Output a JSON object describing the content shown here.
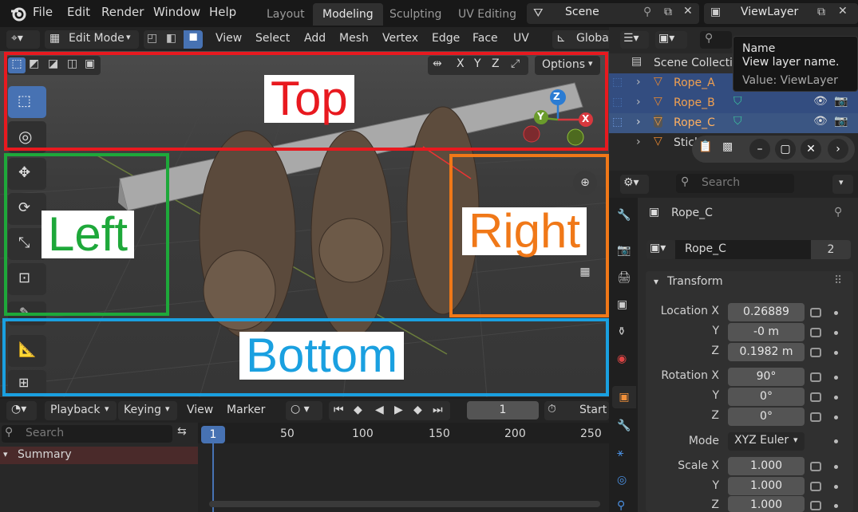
{
  "topbar": {
    "menus": [
      "File",
      "Edit",
      "Render",
      "Window",
      "Help"
    ],
    "workspaces": [
      "Layout",
      "Modeling",
      "Sculpting",
      "UV Editing"
    ],
    "active_workspace": "Modeling",
    "scene": "Scene",
    "view_layer": "ViewLayer"
  },
  "viewport_header": {
    "mode": "Edit Mode",
    "menus": [
      "View",
      "Select",
      "Add",
      "Mesh",
      "Vertex",
      "Edge",
      "Face",
      "UV"
    ],
    "transform_orientation": "Globa",
    "axis_x": "X",
    "axis_y": "Y",
    "axis_z": "Z",
    "options": "Options"
  },
  "gizmo": {
    "z": "Z",
    "y": "Y",
    "x": "X"
  },
  "overlays": {
    "top": {
      "label": "Top",
      "color": "#e8191f"
    },
    "left": {
      "label": "Left",
      "color": "#1ea83a"
    },
    "right": {
      "label": "Right",
      "color": "#f07818"
    },
    "bottom": {
      "label": "Bottom",
      "color": "#1aa0e0"
    }
  },
  "timeline": {
    "menus": [
      "Playback",
      "Keying",
      "View",
      "Marker"
    ],
    "current_frame": "1",
    "start_label": "Start",
    "search_placeholder": "Search",
    "summary": "Summary",
    "ruler": [
      "1",
      "50",
      "100",
      "150",
      "200",
      "250"
    ]
  },
  "outliner": {
    "header": "Scene Collecti",
    "items": [
      "Rope_A",
      "Rope_B",
      "Rope_C",
      "Stick"
    ]
  },
  "tooltip": {
    "title": "Name",
    "desc": "View layer name.",
    "value": "Value: ViewLayer"
  },
  "properties": {
    "search_placeholder": "Search",
    "object_name": "Rope_C",
    "mesh_name": "Rope_C",
    "mesh_users": "2",
    "panel": "Transform",
    "location_label": "Location X",
    "rotation_label": "Rotation X",
    "scale_label": "Scale X",
    "y_label": "Y",
    "z_label": "Z",
    "loc": [
      "0.26889",
      "-0 m",
      "0.1982 m"
    ],
    "rot": [
      "90°",
      "0°",
      "0°"
    ],
    "mode_label": "Mode",
    "mode_value": "XYZ Euler",
    "scale": [
      "1.000",
      "1.000",
      "1.000"
    ]
  }
}
